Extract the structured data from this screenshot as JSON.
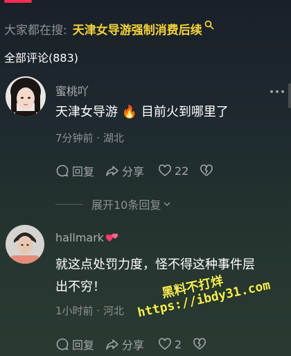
{
  "search_hint": {
    "prefix": "大家都在搜:",
    "keyword": "天津女导游强制消费后续",
    "icon": "search-icon",
    "keyword_color": "#f3d23a"
  },
  "comments_header": {
    "title": "全部评论(883)"
  },
  "comments": [
    {
      "username": "蜜桃吖",
      "text": "天津女导游",
      "emoji": "🔥",
      "text_after": "目前火到哪里了",
      "meta": "7分钟前 · 湖北",
      "reply_label": "回复",
      "share_label": "分享",
      "like_count": "22",
      "more_icon": "more-dots-icon"
    },
    {
      "username": "hallmark",
      "badge_icon": "hearts-icon",
      "text_line1": "就这点处罚力度，怪不得这种事件层",
      "text_line2": "出不穷！",
      "meta": "1小时前 · 河北",
      "reply_label": "回复",
      "share_label": "分享",
      "like_count": "2"
    }
  ],
  "expand_replies": {
    "label": "展开10条回复"
  },
  "watermark": {
    "line1": "黑料不打烊",
    "line2": "https://ibdy31.com"
  },
  "colors": {
    "accent": "#fe2c55",
    "highlight": "#f3d23a"
  }
}
